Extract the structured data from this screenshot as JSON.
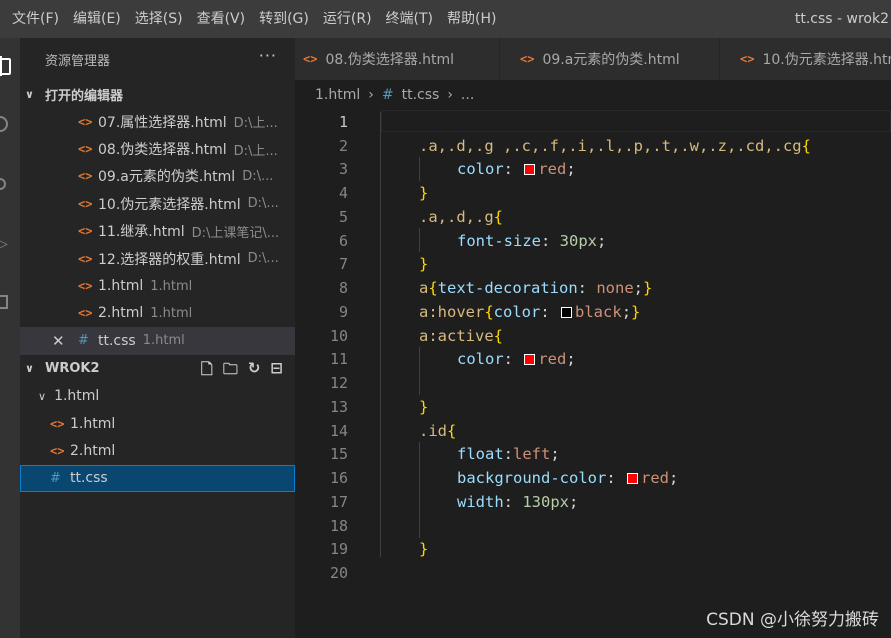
{
  "menu": [
    "文件(F)",
    "编辑(E)",
    "选择(S)",
    "查看(V)",
    "转到(G)",
    "运行(R)",
    "终端(T)",
    "帮助(H)"
  ],
  "window_title": "tt.css - wrok2",
  "sidebar": {
    "title": "资源管理器",
    "more": "···",
    "open_editors": {
      "header": "打开的编辑器",
      "items": [
        {
          "name": "07.属性选择器.html",
          "desc": "D:\\上..."
        },
        {
          "name": "08.伪类选择器.html",
          "desc": "D:\\上..."
        },
        {
          "name": "09.a元素的伪类.html",
          "desc": "D:\\..."
        },
        {
          "name": "10.伪元素选择器.html",
          "desc": "D:\\..."
        },
        {
          "name": "11.继承.html",
          "desc": "D:\\上课笔记\\..."
        },
        {
          "name": "12.选择器的权重.html",
          "desc": "D:\\..."
        },
        {
          "name": "1.html",
          "desc": "1.html"
        },
        {
          "name": "2.html",
          "desc": "1.html"
        },
        {
          "name": "tt.css",
          "desc": "1.html"
        }
      ]
    },
    "workspace": {
      "header": "WROK2",
      "folder": "1.html",
      "files": [
        "1.html",
        "2.html",
        "tt.css"
      ]
    }
  },
  "tabs": [
    "08.伪类选择器.html",
    "09.a元素的伪类.html",
    "10.伪元素选择器.html"
  ],
  "breadcrumb": {
    "root": "1.html",
    "file": "tt.css",
    "tail": "..."
  },
  "editor": {
    "line_numbers": [
      "1",
      "2",
      "3",
      "4",
      "5",
      "6",
      "7",
      "8",
      "9",
      "10",
      "11",
      "12",
      "13",
      "14",
      "15",
      "16",
      "17",
      "18",
      "19",
      "20"
    ],
    "code": {
      "l2_selector": ".a,.d,.g ,.c,.f,.i,.l,.p,.t,.w,.z,.cd,.cg",
      "l5_selector": ".a,.d,.g",
      "l14_selector": ".id",
      "colors": {
        "red": "#ff0000",
        "black": "#000000"
      }
    }
  },
  "watermark": "CSDN @小徐努力搬砖"
}
